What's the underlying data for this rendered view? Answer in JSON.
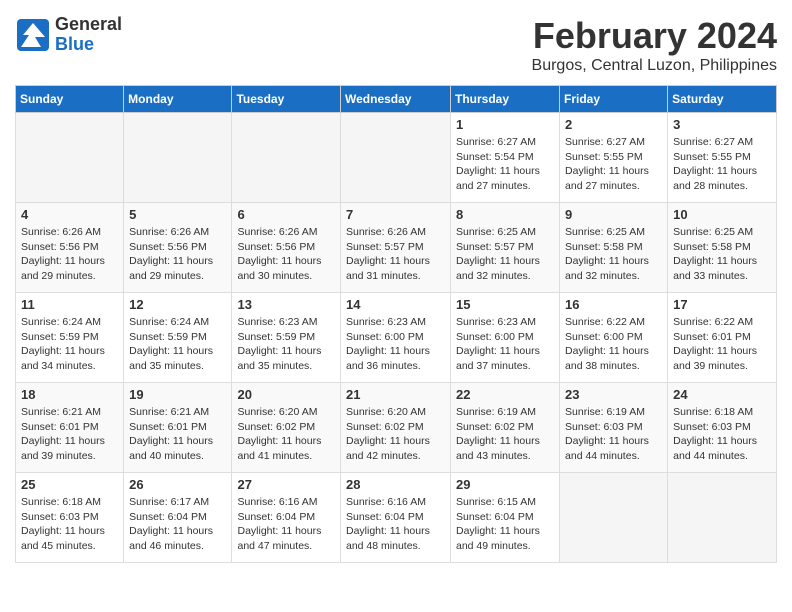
{
  "header": {
    "logo_general": "General",
    "logo_blue": "Blue",
    "month_year": "February 2024",
    "location": "Burgos, Central Luzon, Philippines"
  },
  "days_of_week": [
    "Sunday",
    "Monday",
    "Tuesday",
    "Wednesday",
    "Thursday",
    "Friday",
    "Saturday"
  ],
  "weeks": [
    [
      {
        "day": "",
        "info": ""
      },
      {
        "day": "",
        "info": ""
      },
      {
        "day": "",
        "info": ""
      },
      {
        "day": "",
        "info": ""
      },
      {
        "day": "1",
        "info": "Sunrise: 6:27 AM\nSunset: 5:54 PM\nDaylight: 11 hours and 27 minutes."
      },
      {
        "day": "2",
        "info": "Sunrise: 6:27 AM\nSunset: 5:55 PM\nDaylight: 11 hours and 27 minutes."
      },
      {
        "day": "3",
        "info": "Sunrise: 6:27 AM\nSunset: 5:55 PM\nDaylight: 11 hours and 28 minutes."
      }
    ],
    [
      {
        "day": "4",
        "info": "Sunrise: 6:26 AM\nSunset: 5:56 PM\nDaylight: 11 hours and 29 minutes."
      },
      {
        "day": "5",
        "info": "Sunrise: 6:26 AM\nSunset: 5:56 PM\nDaylight: 11 hours and 29 minutes."
      },
      {
        "day": "6",
        "info": "Sunrise: 6:26 AM\nSunset: 5:56 PM\nDaylight: 11 hours and 30 minutes."
      },
      {
        "day": "7",
        "info": "Sunrise: 6:26 AM\nSunset: 5:57 PM\nDaylight: 11 hours and 31 minutes."
      },
      {
        "day": "8",
        "info": "Sunrise: 6:25 AM\nSunset: 5:57 PM\nDaylight: 11 hours and 32 minutes."
      },
      {
        "day": "9",
        "info": "Sunrise: 6:25 AM\nSunset: 5:58 PM\nDaylight: 11 hours and 32 minutes."
      },
      {
        "day": "10",
        "info": "Sunrise: 6:25 AM\nSunset: 5:58 PM\nDaylight: 11 hours and 33 minutes."
      }
    ],
    [
      {
        "day": "11",
        "info": "Sunrise: 6:24 AM\nSunset: 5:59 PM\nDaylight: 11 hours and 34 minutes."
      },
      {
        "day": "12",
        "info": "Sunrise: 6:24 AM\nSunset: 5:59 PM\nDaylight: 11 hours and 35 minutes."
      },
      {
        "day": "13",
        "info": "Sunrise: 6:23 AM\nSunset: 5:59 PM\nDaylight: 11 hours and 35 minutes."
      },
      {
        "day": "14",
        "info": "Sunrise: 6:23 AM\nSunset: 6:00 PM\nDaylight: 11 hours and 36 minutes."
      },
      {
        "day": "15",
        "info": "Sunrise: 6:23 AM\nSunset: 6:00 PM\nDaylight: 11 hours and 37 minutes."
      },
      {
        "day": "16",
        "info": "Sunrise: 6:22 AM\nSunset: 6:00 PM\nDaylight: 11 hours and 38 minutes."
      },
      {
        "day": "17",
        "info": "Sunrise: 6:22 AM\nSunset: 6:01 PM\nDaylight: 11 hours and 39 minutes."
      }
    ],
    [
      {
        "day": "18",
        "info": "Sunrise: 6:21 AM\nSunset: 6:01 PM\nDaylight: 11 hours and 39 minutes."
      },
      {
        "day": "19",
        "info": "Sunrise: 6:21 AM\nSunset: 6:01 PM\nDaylight: 11 hours and 40 minutes."
      },
      {
        "day": "20",
        "info": "Sunrise: 6:20 AM\nSunset: 6:02 PM\nDaylight: 11 hours and 41 minutes."
      },
      {
        "day": "21",
        "info": "Sunrise: 6:20 AM\nSunset: 6:02 PM\nDaylight: 11 hours and 42 minutes."
      },
      {
        "day": "22",
        "info": "Sunrise: 6:19 AM\nSunset: 6:02 PM\nDaylight: 11 hours and 43 minutes."
      },
      {
        "day": "23",
        "info": "Sunrise: 6:19 AM\nSunset: 6:03 PM\nDaylight: 11 hours and 44 minutes."
      },
      {
        "day": "24",
        "info": "Sunrise: 6:18 AM\nSunset: 6:03 PM\nDaylight: 11 hours and 44 minutes."
      }
    ],
    [
      {
        "day": "25",
        "info": "Sunrise: 6:18 AM\nSunset: 6:03 PM\nDaylight: 11 hours and 45 minutes."
      },
      {
        "day": "26",
        "info": "Sunrise: 6:17 AM\nSunset: 6:04 PM\nDaylight: 11 hours and 46 minutes."
      },
      {
        "day": "27",
        "info": "Sunrise: 6:16 AM\nSunset: 6:04 PM\nDaylight: 11 hours and 47 minutes."
      },
      {
        "day": "28",
        "info": "Sunrise: 6:16 AM\nSunset: 6:04 PM\nDaylight: 11 hours and 48 minutes."
      },
      {
        "day": "29",
        "info": "Sunrise: 6:15 AM\nSunset: 6:04 PM\nDaylight: 11 hours and 49 minutes."
      },
      {
        "day": "",
        "info": ""
      },
      {
        "day": "",
        "info": ""
      }
    ]
  ]
}
